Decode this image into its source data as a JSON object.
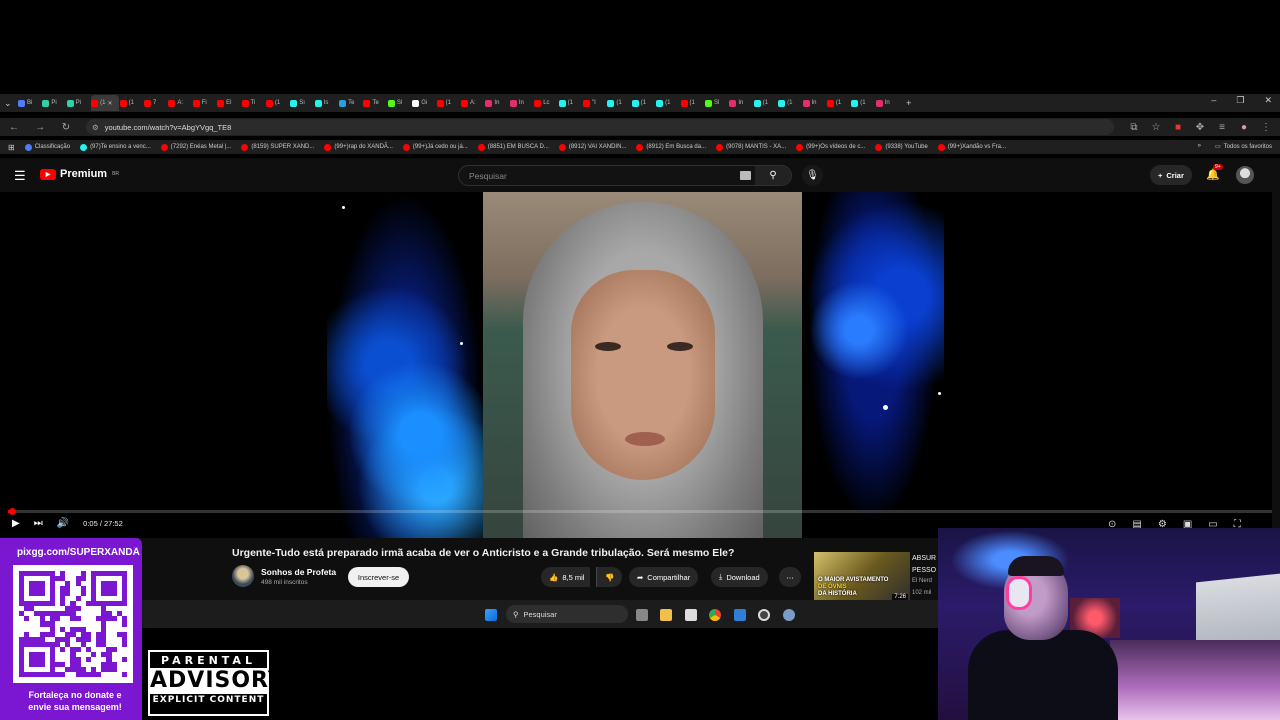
{
  "browser": {
    "tabs": [
      {
        "label": "Bi",
        "color": "#4d7cff"
      },
      {
        "label": "Pi",
        "color": "#2fd1a5"
      },
      {
        "label": "Pi",
        "color": "#2fd1a5"
      },
      {
        "label": "(1",
        "color": "#ff0000",
        "active": true
      },
      {
        "label": "(1",
        "color": "#ff0000"
      },
      {
        "label": "7",
        "color": "#ff0000"
      },
      {
        "label": "A:",
        "color": "#ff0000"
      },
      {
        "label": "Fi",
        "color": "#ff0000"
      },
      {
        "label": "El",
        "color": "#ff0000"
      },
      {
        "label": "Ti",
        "color": "#ff0000"
      },
      {
        "label": "(1",
        "color": "#ff0000"
      },
      {
        "label": "Sı",
        "color": "#25f4ee"
      },
      {
        "label": "Is",
        "color": "#25f4ee"
      },
      {
        "label": "Te",
        "color": "#2aa1da"
      },
      {
        "label": "Te",
        "color": "#ff0000"
      },
      {
        "label": "Sl",
        "color": "#53fc18"
      },
      {
        "label": "Gi",
        "color": "#ffffff"
      },
      {
        "label": "(1",
        "color": "#ff0000"
      },
      {
        "label": "A:",
        "color": "#ff0000"
      },
      {
        "label": "In",
        "color": "#e1306c"
      },
      {
        "label": "In",
        "color": "#e1306c"
      },
      {
        "label": "Lc",
        "color": "#ff0000"
      },
      {
        "label": "(1",
        "color": "#25f4ee"
      },
      {
        "label": "\"I",
        "color": "#ff0000"
      },
      {
        "label": "(1",
        "color": "#25f4ee"
      },
      {
        "label": "(1",
        "color": "#25f4ee"
      },
      {
        "label": "(1",
        "color": "#25f4ee"
      },
      {
        "label": "(1",
        "color": "#ff0000"
      },
      {
        "label": "Sl",
        "color": "#53fc18"
      },
      {
        "label": "In",
        "color": "#e1306c"
      },
      {
        "label": "(1",
        "color": "#25f4ee"
      },
      {
        "label": "(1",
        "color": "#25f4ee"
      },
      {
        "label": "In",
        "color": "#e1306c"
      },
      {
        "label": "(1",
        "color": "#ff0000"
      },
      {
        "label": "(1",
        "color": "#25f4ee"
      },
      {
        "label": "In",
        "color": "#e1306c"
      }
    ],
    "new_tab": "+",
    "address": "youtube.com/watch?v=AbgYVgq_TE8",
    "bookmarks": [
      {
        "label": "Classificação",
        "color": "#4d7cff"
      },
      {
        "label": "(97)Te ensino a venc...",
        "color": "#25f4ee"
      },
      {
        "label": "(7292) Enéas Metal |...",
        "color": "#ff0000"
      },
      {
        "label": "(8159) SUPER XAND...",
        "color": "#ff0000"
      },
      {
        "label": "(99+)rap do XANDÃ...",
        "color": "#ff0000"
      },
      {
        "label": "(99+)Já cedo ou já...",
        "color": "#ff0000"
      },
      {
        "label": "(8851) EM BUSCA D...",
        "color": "#ff0000"
      },
      {
        "label": "(8912) VAI XANDIN...",
        "color": "#ff0000"
      },
      {
        "label": "(8912) Em Busca da...",
        "color": "#ff0000"
      },
      {
        "label": "(9078) MANTIS - XA...",
        "color": "#ff0000"
      },
      {
        "label": "(99+)Os vídeos de c...",
        "color": "#ff0000"
      },
      {
        "label": "(9338) YouTube",
        "color": "#ff0000"
      },
      {
        "label": "(99+)Xandão vs Fra...",
        "color": "#ff0000"
      }
    ],
    "bookmarks_more": "»",
    "all_bookmarks": "Todos os favoritos"
  },
  "youtube": {
    "logo_text": "Premium",
    "logo_region": "BR",
    "search_placeholder": "Pesquisar",
    "create_label": "Criar",
    "notif_badge": "9+",
    "player": {
      "time": "0:05 / 27:52",
      "progress": 0.003
    },
    "video_title": "Urgente-Tudo está preparado irmã acaba de ver o Anticristo e a Grande tribulação. Será mesmo Ele?",
    "channel_name": "Sonhos de Profeta",
    "channel_subs": "498 mil inscritos",
    "subscribe_label": "Inscrever-se",
    "likes": "8,5 mil",
    "share_label": "Compartilhar",
    "download_label": "Download",
    "more_label": "⋯",
    "recommended": {
      "title_l1": "ABSUR",
      "title_l2": "PESSO",
      "channel": "El Nerd",
      "views": "102 mil",
      "duration": "7:26",
      "thumb_caption_l1": "O MAIOR AVISTAMENTO",
      "thumb_caption_l2": "DE ÓVNIS",
      "thumb_caption_l3": "DA HISTÓRIA"
    }
  },
  "taskbar": {
    "search_label": "Pesquisar"
  },
  "overlay": {
    "donate_url": "pixgg.com/SUPERXANDÃ",
    "donate_msg_l1": "Fortaleça no donate e",
    "donate_msg_l2": "envie sua mensagem!",
    "advisory_top": "PARENTAL",
    "advisory_mid": "ADVISORY",
    "advisory_bot": "EXPLICIT CONTENT"
  },
  "colors": {
    "yt_red": "#ff0000",
    "donate_purple": "#7b16d1",
    "page_bg": "#0f0f0f"
  }
}
